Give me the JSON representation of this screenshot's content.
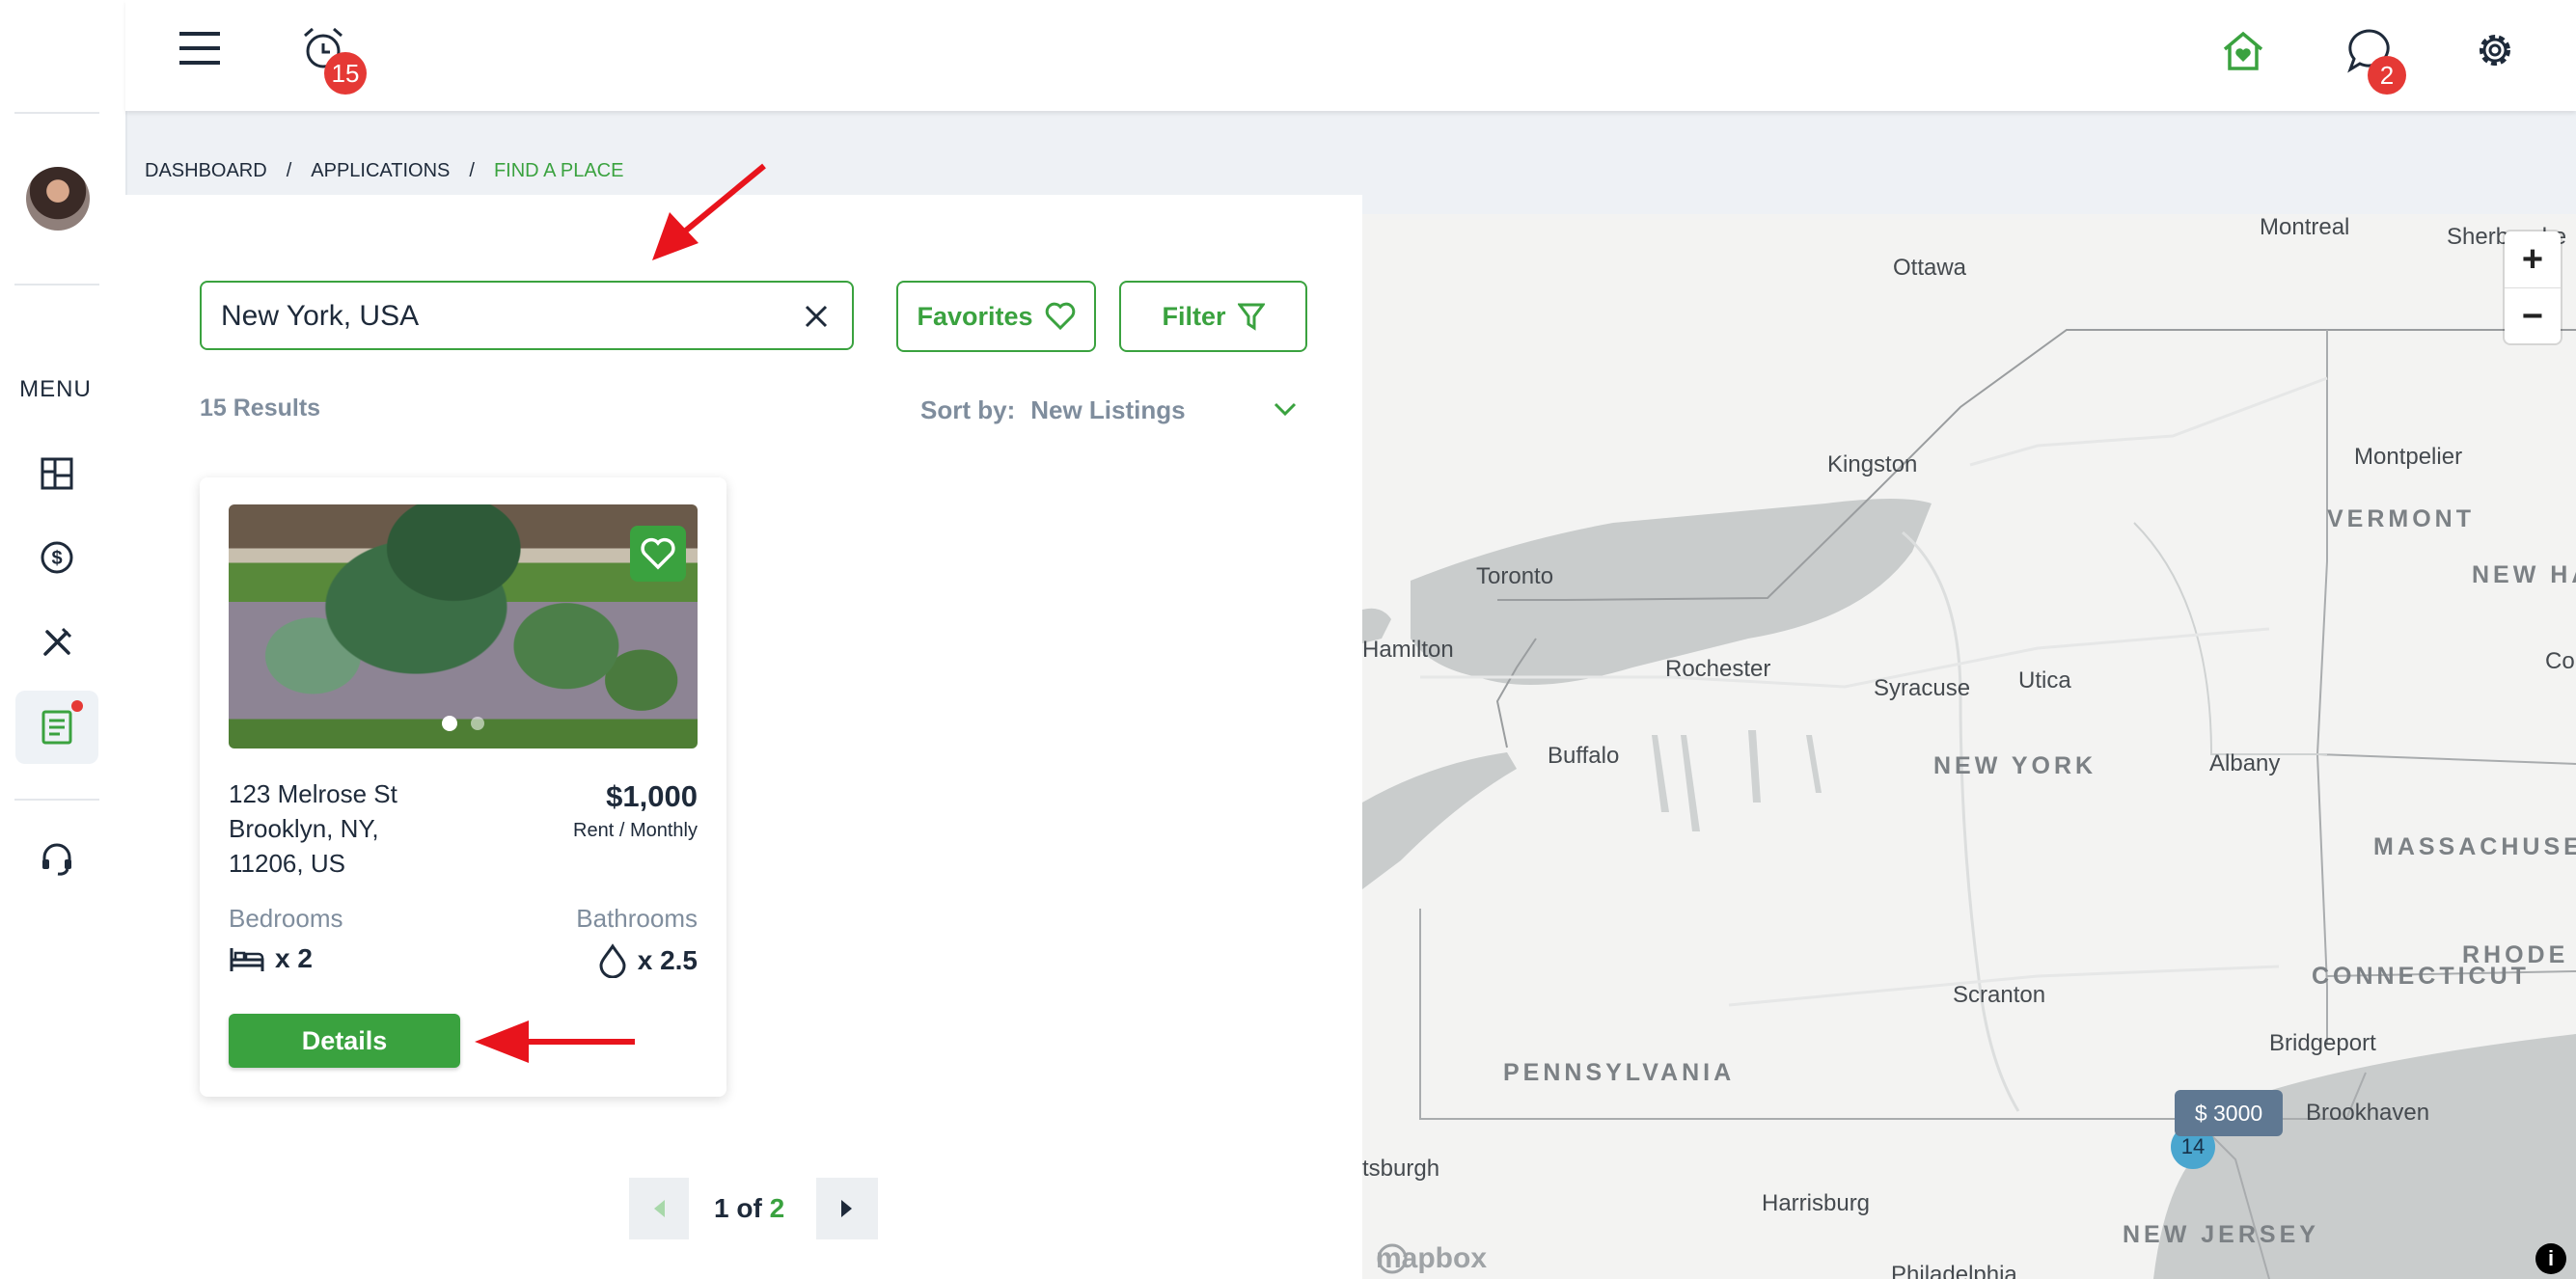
{
  "sidebar": {
    "menu_label": "MENU",
    "items": [
      {
        "name": "dashboard",
        "icon": "dashboard-grid-icon"
      },
      {
        "name": "payments",
        "icon": "dollar-circle-icon"
      },
      {
        "name": "maintenance",
        "icon": "tools-icon"
      },
      {
        "name": "applications",
        "icon": "document-icon",
        "active": true,
        "has_notification": true
      },
      {
        "name": "support",
        "icon": "headset-icon"
      }
    ]
  },
  "header": {
    "notifications_count": "15",
    "messages_count": "2"
  },
  "breadcrumb": {
    "items": [
      "DASHBOARD",
      "APPLICATIONS",
      "FIND A PLACE"
    ],
    "separator": "/"
  },
  "search": {
    "value": "New York, USA",
    "favorites_label": "Favorites",
    "filter_label": "Filter"
  },
  "results": {
    "count_label": "15 Results",
    "sort_label": "Sort by:",
    "sort_value": "New Listings"
  },
  "listing": {
    "address_line1": "123 Melrose St",
    "address_line2": "Brooklyn, NY,",
    "address_line3": "11206, US",
    "price": "$1,000",
    "price_period": "Rent / Monthly",
    "bedrooms_label": "Bedrooms",
    "bedrooms_value": "x 2",
    "bathrooms_label": "Bathrooms",
    "bathrooms_value": "x 2.5",
    "details_label": "Details",
    "photo_count": 2,
    "photo_index": 1
  },
  "pagination": {
    "current": "1",
    "of": "of",
    "total": "2"
  },
  "map": {
    "cities": [
      "Montreal",
      "Ottawa",
      "Sherbrooke",
      "Kingston",
      "Montpelier",
      "Toronto",
      "Hamilton",
      "Rochester",
      "Syracuse",
      "Utica",
      "Buffalo",
      "Albany",
      "Scranton",
      "Bridgeport",
      "Brookhaven",
      "Harrisburg",
      "Pittsburgh",
      "Philadelphia"
    ],
    "states": [
      "VERMONT",
      "NEW HAMPSHIRE",
      "NEW YORK",
      "MASSACHUSETTS",
      "CONNECTICUT",
      "RHODE ISLAND",
      "PENNSYLVANIA",
      "NEW JERSEY"
    ],
    "extra_labels": [
      "Concord"
    ],
    "price_marker": "$ 3000",
    "cluster_count": "14",
    "zoom_in": "+",
    "zoom_out": "−",
    "attribution": "mapbox",
    "info": "i"
  },
  "colors": {
    "brand_green": "#3aa23f",
    "badge_red": "#e53935",
    "muted_text": "#7f8d9d",
    "marker_slate": "#5f7892",
    "cluster_blue": "#4aa6cf",
    "annotation_red": "#e8141c"
  }
}
